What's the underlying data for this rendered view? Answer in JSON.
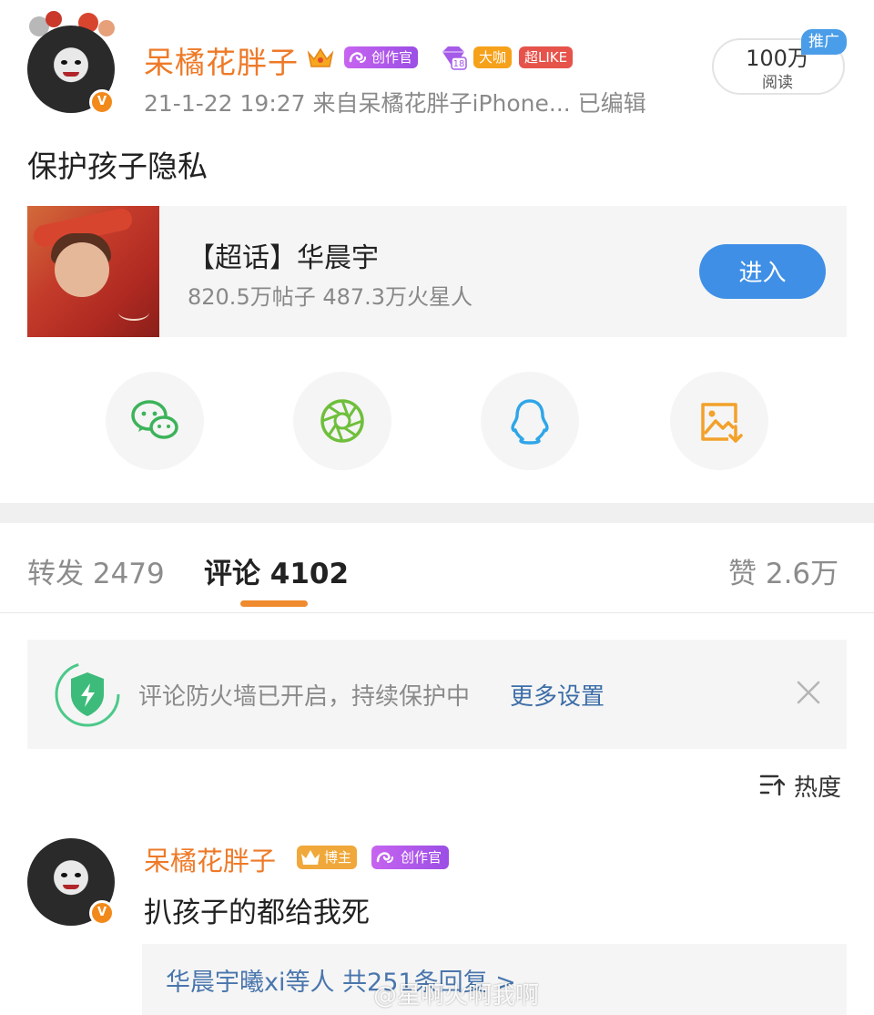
{
  "post": {
    "username": "呆橘花胖子",
    "badges": {
      "creator": "创作官",
      "big": "大咖",
      "like": "超LIKE",
      "level": "18"
    },
    "verified_mark": "V",
    "meta": "21-1-22 19:27  来自呆橘花胖子iPhone...  已编辑",
    "reads": {
      "count": "100万",
      "label": "阅读"
    },
    "promo_label": "推广",
    "text": "保护孩子隐私"
  },
  "supertopic_card": {
    "title": "【超话】华晨宇",
    "stats": "820.5万帖子 487.3万火星人",
    "enter_button": "进入"
  },
  "share_icons": [
    "wechat-icon",
    "moments-icon",
    "qq-icon",
    "save-image-icon"
  ],
  "tabs": {
    "repost": "转发 2479",
    "comment": "评论 4102",
    "like": "赞 2.6万"
  },
  "notice": {
    "text": "评论防火墙已开启，持续保护中",
    "link": "更多设置"
  },
  "sort": {
    "label": "热度"
  },
  "comment": {
    "username": "呆橘花胖子",
    "badge_host": "博主",
    "badge_creator": "创作官",
    "verified_mark": "V",
    "text": "扒孩子的都给我死",
    "replies": "华晨宇曦xi等人  共251条回复 >"
  },
  "watermark": "@星啊火啊我啊",
  "colors": {
    "username": "#ee7a28",
    "accent_blue": "#3f8fe6",
    "tab_underline": "#f08a2e",
    "link_blue": "#3d6ea8"
  }
}
